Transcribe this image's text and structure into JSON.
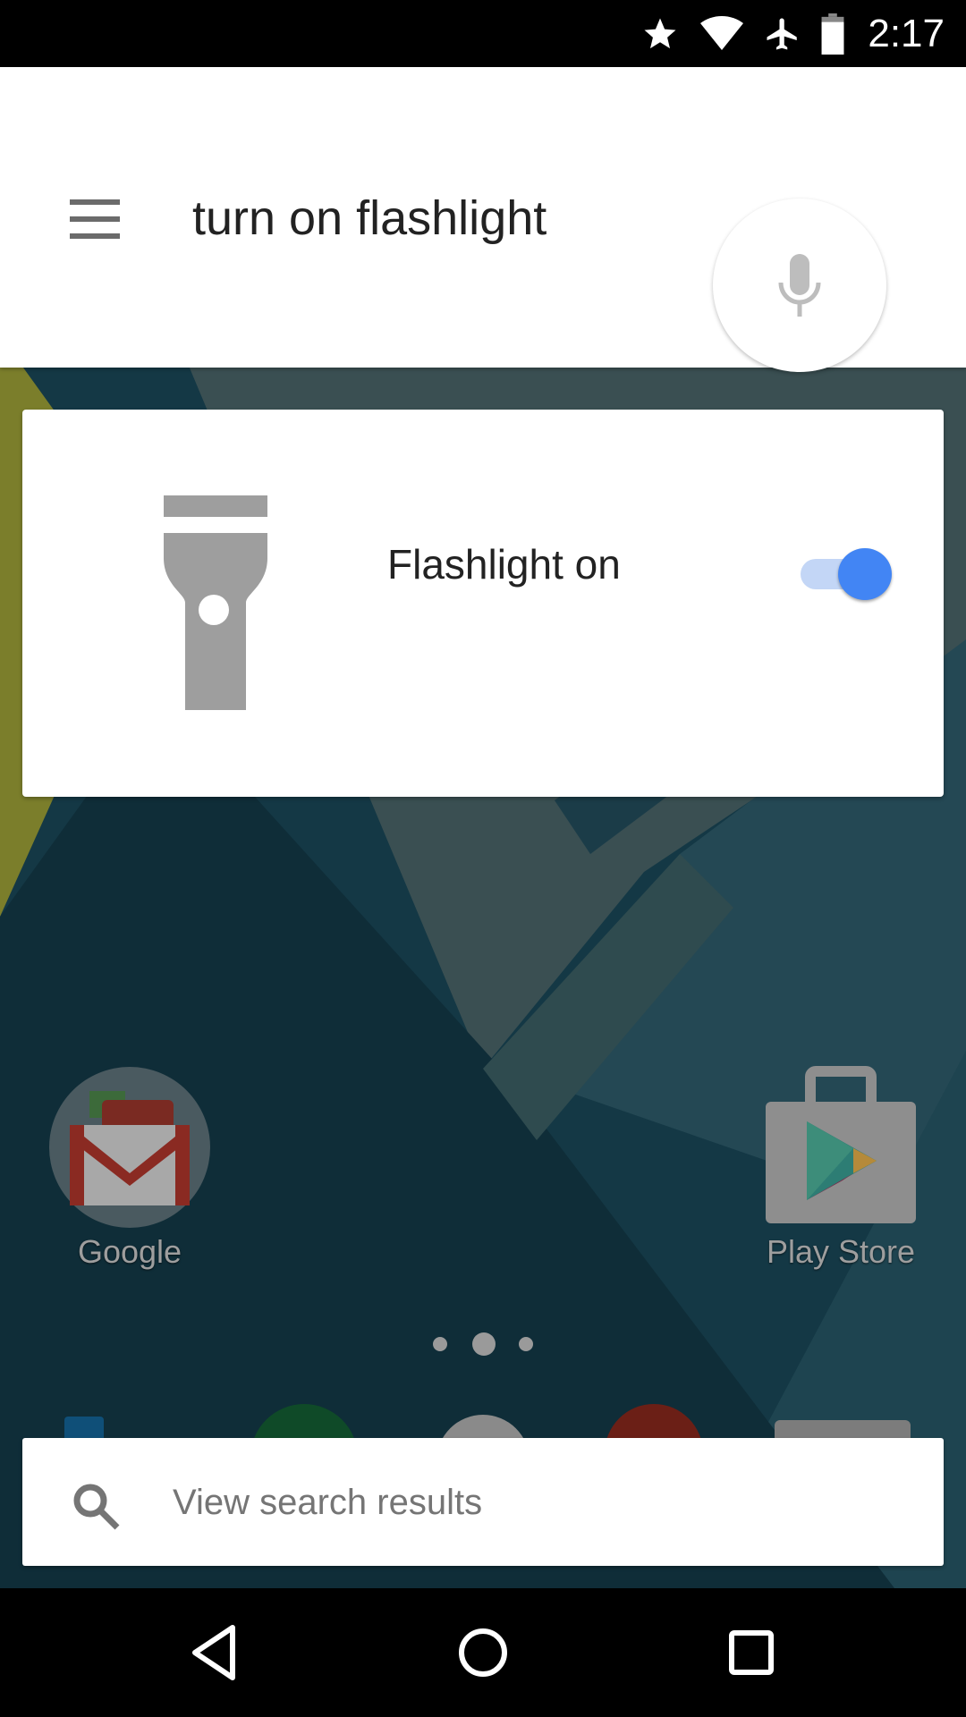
{
  "status_bar": {
    "time": "2:17",
    "icons": [
      "star-icon",
      "wifi-icon",
      "airplane-mode-icon",
      "battery-icon"
    ]
  },
  "query": {
    "text": "turn on flashlight",
    "menu_icon": "hamburger-menu-icon",
    "mic_icon": "microphone-icon"
  },
  "flashlight_card": {
    "label": "Flashlight on",
    "icon": "flashlight-icon",
    "toggle_on": true,
    "accent_color": "#4285f4"
  },
  "home_screen": {
    "apps": [
      {
        "label": "Google",
        "icon": "google-folder-icon"
      },
      {
        "label": "Play Store",
        "icon": "play-store-icon"
      }
    ],
    "page_indicator": {
      "pages": 3,
      "current": 2
    }
  },
  "search_results": {
    "label": "View search results",
    "icon": "search-icon"
  },
  "nav_bar": {
    "buttons": [
      "back",
      "home",
      "recents"
    ]
  }
}
